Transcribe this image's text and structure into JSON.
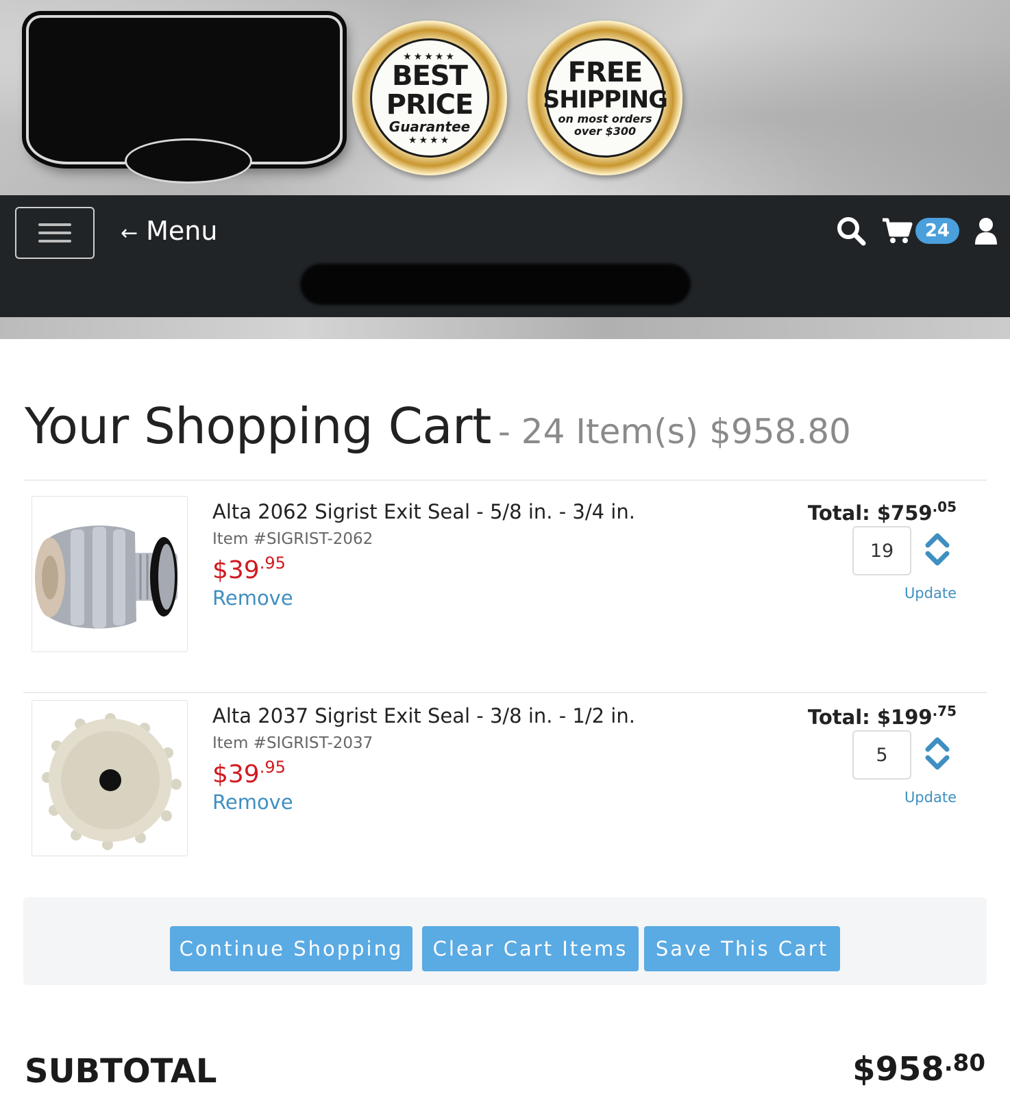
{
  "header": {
    "badges": [
      {
        "line1": "BEST",
        "line2": "PRICE",
        "line3": "Guarantee"
      },
      {
        "line1": "FREE",
        "line2": "SHIPPING",
        "line3": "on most orders",
        "line4": "over $300"
      }
    ]
  },
  "nav": {
    "menu_arrow": "←",
    "menu_label": "Menu",
    "cart_count": "24",
    "icons": [
      "hamburger-icon",
      "search-icon",
      "cart-icon",
      "user-icon"
    ]
  },
  "page": {
    "title": "Your Shopping Cart",
    "summary": "- 24 Item(s) $958.80"
  },
  "cart": {
    "items": [
      {
        "name": "Alta 2062 Sigrist Exit Seal - 5/8 in. - 3/4 in.",
        "sku": "Item #SIGRIST-2062",
        "price_whole": "$39",
        "price_cents": ".95",
        "remove_label": "Remove",
        "total_label": "Total: $759",
        "total_cents": ".05",
        "quantity": "19",
        "update_label": "Update"
      },
      {
        "name": "Alta 2037 Sigrist Exit Seal - 3/8 in. - 1/2 in.",
        "sku": "Item #SIGRIST-2037",
        "price_whole": "$39",
        "price_cents": ".95",
        "remove_label": "Remove",
        "total_label": "Total: $199",
        "total_cents": ".75",
        "quantity": "5",
        "update_label": "Update"
      }
    ]
  },
  "actions": {
    "continue_label": "Continue Shopping",
    "clear_label": "Clear Cart Items",
    "save_label": "Save This Cart"
  },
  "subtotal": {
    "label": "SUBTOTAL",
    "value_whole": "$958",
    "value_cents": ".80"
  },
  "colors": {
    "navbar": "#212427",
    "accent_blue": "#5aaae3",
    "link_blue": "#3f8fc1",
    "price_red": "#d0191f"
  }
}
